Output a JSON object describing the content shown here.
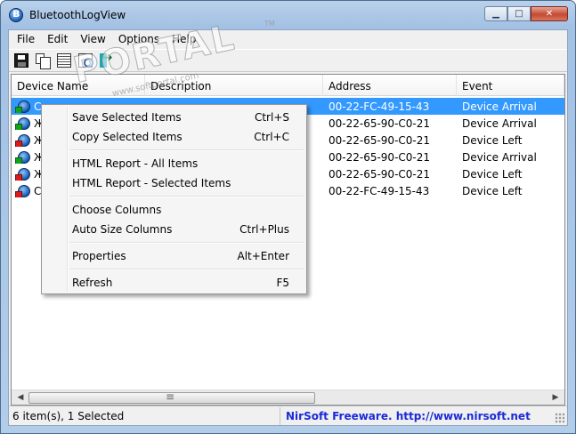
{
  "window": {
    "title": "BluetoothLogView",
    "controls": [
      "minimize",
      "maximize",
      "close"
    ]
  },
  "menubar": {
    "items": [
      "File",
      "Edit",
      "View",
      "Options",
      "Help"
    ]
  },
  "toolbar": {
    "icons": [
      "save-icon",
      "copy-icon",
      "properties-icon",
      "find-icon",
      "exit-icon"
    ]
  },
  "list": {
    "columns": [
      "Device Name",
      "Description",
      "Address",
      "Event"
    ],
    "rows": [
      {
        "name": "С",
        "address": "00-22-FC-49-15-43",
        "event": "Device Arrival",
        "type": "arrival",
        "selected": true
      },
      {
        "name": "Ж",
        "address": "00-22-65-90-C0-21",
        "event": "Device Arrival",
        "type": "arrival",
        "selected": false
      },
      {
        "name": "Ж",
        "address": "00-22-65-90-C0-21",
        "event": "Device Left",
        "type": "left",
        "selected": false
      },
      {
        "name": "Ж",
        "address": "00-22-65-90-C0-21",
        "event": "Device Arrival",
        "type": "arrival",
        "selected": false
      },
      {
        "name": "Ж",
        "address": "00-22-65-90-C0-21",
        "event": "Device Left",
        "type": "left",
        "selected": false
      },
      {
        "name": "Се",
        "address": "00-22-FC-49-15-43",
        "event": "Device Left",
        "type": "left",
        "selected": false
      }
    ]
  },
  "context_menu": {
    "items": [
      {
        "label": "Save Selected Items",
        "shortcut": "Ctrl+S"
      },
      {
        "label": "Copy Selected Items",
        "shortcut": "Ctrl+C"
      },
      {
        "label": "HTML Report - All Items",
        "shortcut": ""
      },
      {
        "label": "HTML Report - Selected Items",
        "shortcut": ""
      },
      {
        "label": "Choose Columns",
        "shortcut": ""
      },
      {
        "label": "Auto Size Columns",
        "shortcut": "Ctrl+Plus"
      },
      {
        "label": "Properties",
        "shortcut": "Alt+Enter"
      },
      {
        "label": "Refresh",
        "shortcut": "F5"
      }
    ]
  },
  "statusbar": {
    "count": "6 item(s), 1 Selected",
    "credit": "NirSoft Freeware.  http://www.nirsoft.net"
  },
  "watermark": {
    "text": "PORTAL",
    "sub": "www.softportal.com",
    "tm": "TM"
  },
  "colors": {
    "selection": "#3399ff",
    "link": "#1a2bd9"
  }
}
